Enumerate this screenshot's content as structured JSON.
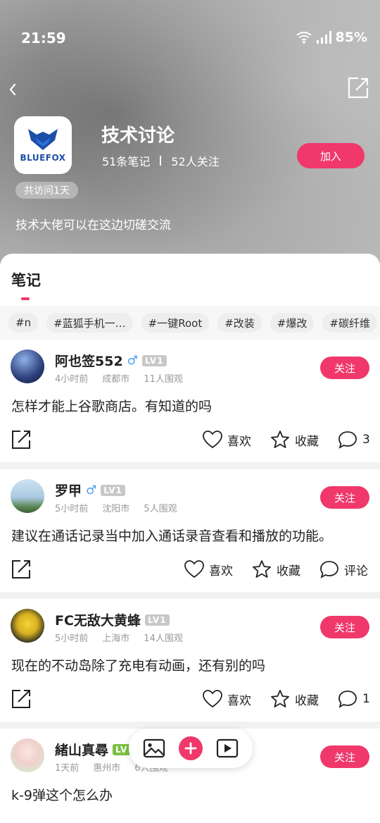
{
  "status": {
    "time": "21:59",
    "battery": "85%"
  },
  "group": {
    "title": "技术讨论",
    "notes_count": "51条笔记",
    "followers": "52人关注",
    "join_label": "加入",
    "visit_badge": "共访问1天",
    "description": "技术大佬可以在这边切磋交流",
    "logo_text": "BLUEFOX"
  },
  "tabs": {
    "notes": "笔记"
  },
  "tags": [
    "#n",
    "#蓝狐手机一…",
    "#一键Root",
    "#改装",
    "#爆改",
    "#碳纤维"
  ],
  "posts": [
    {
      "author": "阿也签552",
      "gender": "♂",
      "level": "LV1",
      "time": "4小时前",
      "city": "成都市",
      "views": "11人围观",
      "follow": "关注",
      "content": "怎样才能上谷歌商店。有知道的吗",
      "like": "喜欢",
      "fav": "收藏",
      "comment": "3"
    },
    {
      "author": "罗甲",
      "gender": "♂",
      "level": "LV1",
      "time": "5小时前",
      "city": "沈阳市",
      "views": "5人围观",
      "follow": "关注",
      "content": "建议在通话记录当中加入通话录音查看和播放的功能。",
      "like": "喜欢",
      "fav": "收藏",
      "comment": "评论"
    },
    {
      "author": "FC无敌大黄蜂",
      "gender": "",
      "level": "LV1",
      "time": "5小时前",
      "city": "上海市",
      "views": "14人围观",
      "follow": "关注",
      "content": "现在的不动岛除了充电有动画，还有别的吗",
      "like": "喜欢",
      "fav": "收藏",
      "comment": "1"
    },
    {
      "author": "緒山真尋",
      "gender": "",
      "level": "LV",
      "time": "1天前",
      "city": "惠州市",
      "views": "6人围观",
      "follow": "关注",
      "content": "k-9弹这个怎么办",
      "like": "",
      "fav": "",
      "comment": ""
    }
  ],
  "colors": {
    "accent": "#f0386b",
    "male": "#4a9df0"
  }
}
